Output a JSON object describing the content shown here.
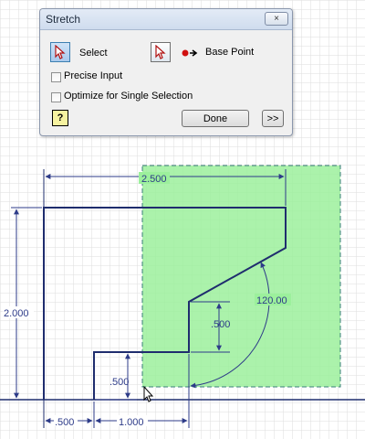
{
  "dialog": {
    "title": "Stretch",
    "close_glyph": "×",
    "select_label": "Select",
    "base_point_label": "Base Point",
    "precise_input_label": "Precise Input",
    "optimize_label": "Optimize for Single Selection",
    "done_label": "Done",
    "expand_label": ">>",
    "help_label": "?"
  },
  "drawing": {
    "dims": {
      "top_width": "2.500",
      "left_height": "2.000",
      "bottom_left": ".500",
      "bottom_right": "1.000",
      "step_height": ".500",
      "inner_height": ".500",
      "angle": "120.00"
    }
  },
  "icons": [
    "select-arrow-icon",
    "base-point-icon",
    "help-icon",
    "close-icon"
  ],
  "colors": {
    "geometry": "#1f2d6e",
    "dimension": "#2d3b88",
    "selection_fill": "#9cf09c",
    "selection_border": "#3a7f7a",
    "grid": "#d8d8d8",
    "dialog_bg": "#f0f0f0"
  }
}
